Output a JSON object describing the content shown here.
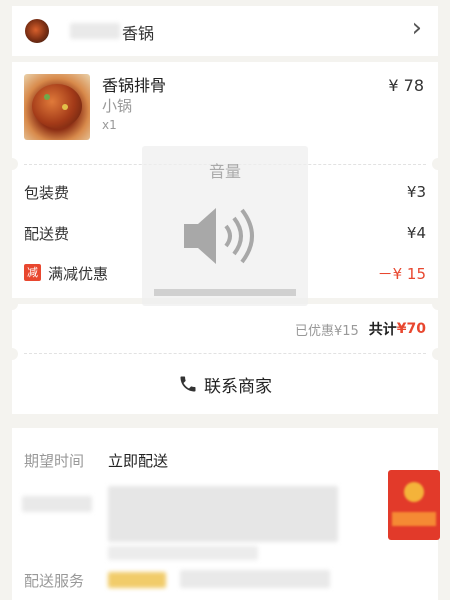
{
  "shop": {
    "name": "香锅",
    "chevron": "›",
    "logo_icon": "shop-logo"
  },
  "item": {
    "name": "香锅排骨",
    "spec": "小锅",
    "qty": "x1",
    "price": "¥ 78"
  },
  "fees": [
    {
      "label": "包装费",
      "value": "¥3"
    },
    {
      "label": "配送费",
      "value": "¥4"
    }
  ],
  "discount": {
    "badge": "减",
    "label": "满减优惠",
    "value": "－¥ 15"
  },
  "summary": {
    "saved": "已优惠¥15",
    "total_label": "共计",
    "total": "¥70"
  },
  "contact": {
    "label": "联系商家",
    "icon": "phone-icon"
  },
  "volume": {
    "title": "音量",
    "icon": "speaker-icon",
    "level": 0.0
  },
  "delivery": {
    "time_label": "期望时间",
    "time_value": "立即配送",
    "service_label": "配送服务"
  },
  "colors": {
    "red": "#e8472f",
    "accent": "#f0502a"
  }
}
